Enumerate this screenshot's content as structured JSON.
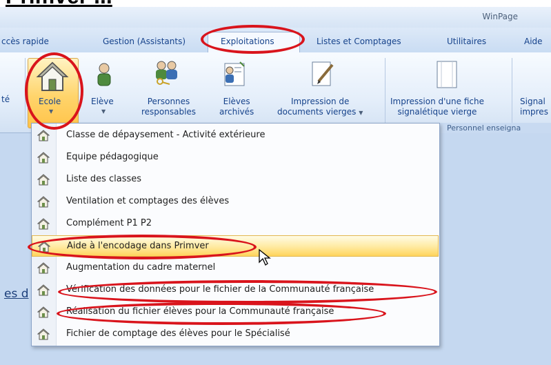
{
  "heading_partial": "Primver ...",
  "window": {
    "title": "WinPage"
  },
  "tabs": [
    {
      "label": "ccès rapide"
    },
    {
      "label": "Gestion (Assistants)"
    },
    {
      "label": "Exploitations"
    },
    {
      "label": "Listes et Comptages"
    },
    {
      "label": "Utilitaires"
    },
    {
      "label": "Aide"
    }
  ],
  "ribbon": {
    "partial_left": "té",
    "ecole": "Ecole",
    "eleve": "Elève",
    "personnes_line1": "Personnes",
    "personnes_line2": "responsables",
    "archives_line1": "Elèves",
    "archives_line2": "archivés",
    "impression_line1": "Impression de",
    "impression_line2": "documents vierges",
    "fiche_line1": "Impression d'une fiche",
    "fiche_line2": "signalétique vierge",
    "signal_line1": "Signal",
    "signal_line2": "impres",
    "group_label": "Personnel enseigna"
  },
  "menu": {
    "items": [
      {
        "label": "Classe de dépaysement - Activité extérieure"
      },
      {
        "label": "Equipe pédagogique"
      },
      {
        "label": "Liste des classes"
      },
      {
        "label": "Ventilation et comptages des élèves"
      },
      {
        "label": "Complément P1 P2"
      },
      {
        "label": "Aide à l'encodage dans Primver"
      },
      {
        "label": "Augmentation du cadre maternel"
      },
      {
        "label": "Vérification des données pour le fichier de la Communauté française"
      },
      {
        "label": "Réalisation du fichier élèves pour la Communauté française"
      },
      {
        "label": "Fichier de comptage des élèves pour le Spécialisé"
      }
    ]
  },
  "workspace": {
    "partial_text": "es d"
  },
  "colors": {
    "highlight_ring": "#d9141c",
    "ribbon_text": "#15428b"
  }
}
